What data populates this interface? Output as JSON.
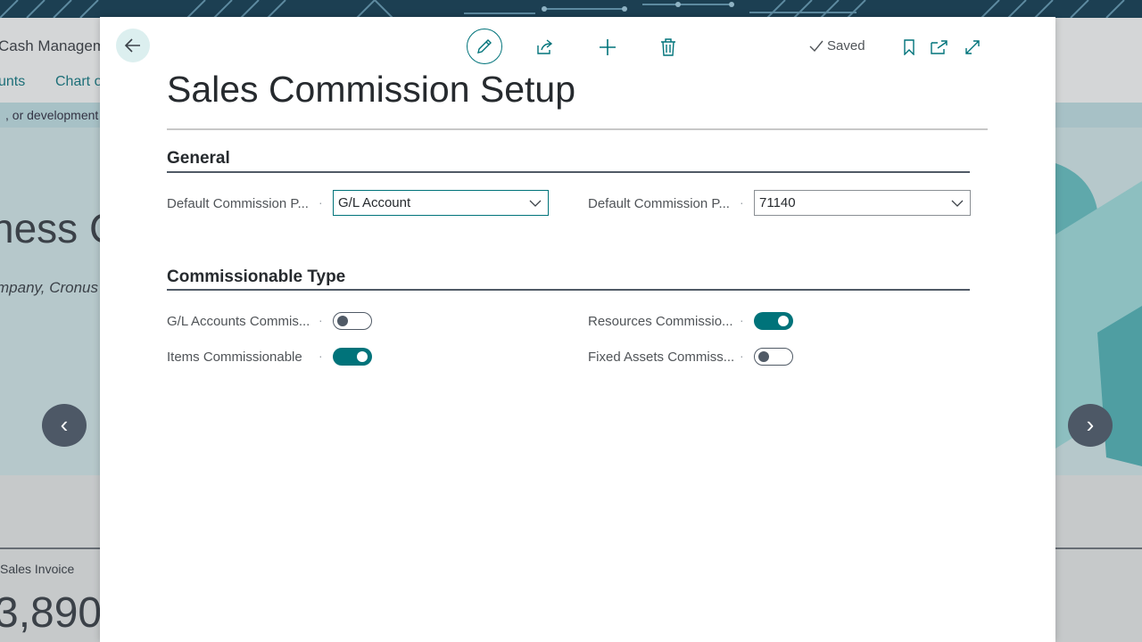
{
  "background": {
    "app_title": "Cash Managem",
    "nav_items": [
      "unts",
      "Chart o"
    ],
    "notice": ", or development",
    "hero_title": "ness C",
    "hero_subtitle": "mpany, Cronus",
    "carousel_prev": "‹",
    "carousel_next": "›",
    "tile_label": "Sales Invoice",
    "tile_value": "3,890"
  },
  "toolbar": {
    "saved_label": "Saved"
  },
  "page": {
    "title": "Sales Commission Setup"
  },
  "general": {
    "heading": "General",
    "fields": [
      {
        "label": "Default Commission P...",
        "value": "G/L Account"
      },
      {
        "label": "Default Commission P...",
        "value": "71140"
      }
    ]
  },
  "commissionable": {
    "heading": "Commissionable Type",
    "toggles": [
      {
        "label": "G/L Accounts Commis...",
        "on": false
      },
      {
        "label": "Resources Commissio...",
        "on": true
      },
      {
        "label": "Items Commissionable",
        "on": true
      },
      {
        "label": "Fixed Assets Commiss...",
        "on": false
      }
    ]
  },
  "colors": {
    "accent": "#00737a",
    "toggle_off": "#505a66"
  }
}
